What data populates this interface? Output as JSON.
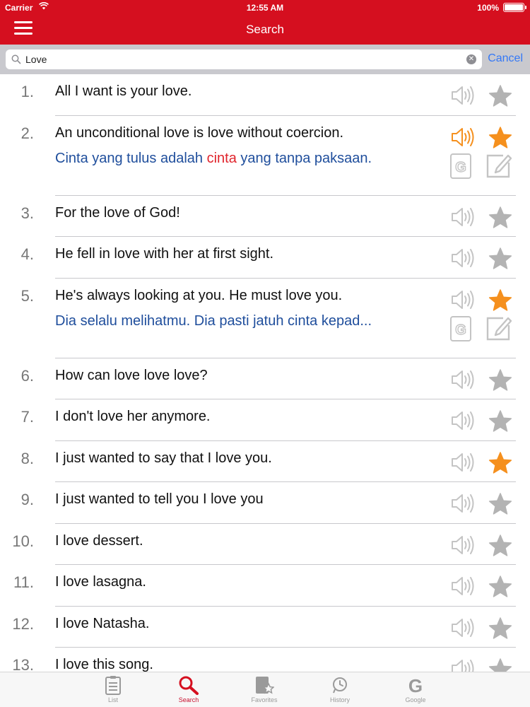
{
  "status_bar": {
    "carrier": "Carrier",
    "time": "12:55 AM",
    "battery": "100%"
  },
  "nav": {
    "title": "Search",
    "menu_icon": "hamburger-menu-icon"
  },
  "search": {
    "value": "Love",
    "cancel_label": "Cancel"
  },
  "colors": {
    "brand": "#d50f1f",
    "star_active": "#f5901e",
    "link_blue": "#3478f6",
    "translation": "#1f4e9c",
    "highlight": "#e0242c"
  },
  "results": [
    {
      "num": "1.",
      "text": "All I want is your love.",
      "favorite": false
    },
    {
      "num": "2.",
      "text": "An unconditional love is love without coercion.",
      "favorite": true,
      "playing": true,
      "translation": {
        "before": "Cinta yang tulus adalah ",
        "highlight": "cinta",
        "after": " yang tanpa paksaan."
      }
    },
    {
      "num": "3.",
      "text": "For the love of God!",
      "favorite": false
    },
    {
      "num": "4.",
      "text": "He fell in love with her at first sight.",
      "favorite": false
    },
    {
      "num": "5.",
      "text": "He's always looking at you. He must love you.",
      "favorite": true,
      "translation": {
        "before": "Dia selalu melihatmu. Dia pasti jatuh cinta kepad...",
        "highlight": "",
        "after": ""
      }
    },
    {
      "num": "6.",
      "text": "How can love love love?",
      "favorite": false
    },
    {
      "num": "7.",
      "text": "I don't love her anymore.",
      "favorite": false
    },
    {
      "num": "8.",
      "text": "I just wanted to say that I love you.",
      "favorite": true
    },
    {
      "num": "9.",
      "text": "I just wanted to tell you I love you",
      "favorite": false
    },
    {
      "num": "10.",
      "text": "I love dessert.",
      "favorite": false
    },
    {
      "num": "11.",
      "text": "I love lasagna.",
      "favorite": false
    },
    {
      "num": "12.",
      "text": "I love Natasha.",
      "favorite": false
    },
    {
      "num": "13.",
      "text": "I love this song.",
      "favorite": false
    }
  ],
  "tabs": [
    {
      "label": "List",
      "icon": "clipboard-list-icon",
      "active": false
    },
    {
      "label": "Search",
      "icon": "magnifier-icon",
      "active": true
    },
    {
      "label": "Favorites",
      "icon": "book-star-icon",
      "active": false
    },
    {
      "label": "History",
      "icon": "clock-history-icon",
      "active": false
    },
    {
      "label": "Google",
      "icon": "google-g-icon",
      "active": false
    }
  ]
}
